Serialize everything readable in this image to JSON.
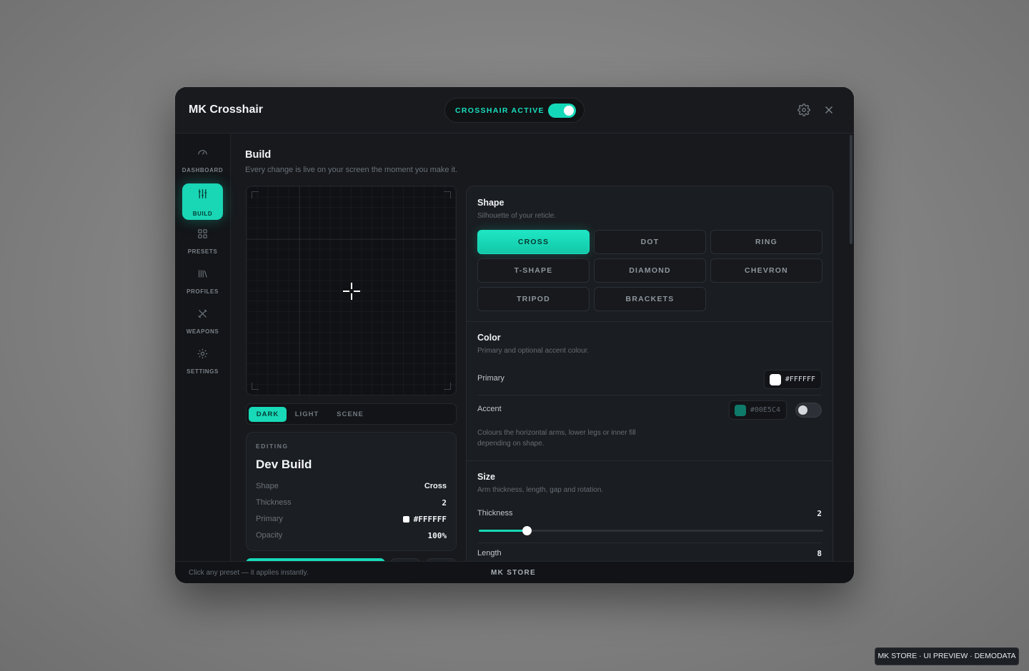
{
  "app": {
    "title": "MK Crosshair",
    "active_label": "CROSSHAIR ACTIVE",
    "active_on": true,
    "accent_color": "#18D9B8",
    "icons": {
      "settings": "gear-icon",
      "close": "close-icon"
    }
  },
  "sidebar": {
    "items": [
      {
        "label": "DASHBOARD",
        "icon": "gauge-icon",
        "active": false
      },
      {
        "label": "BUILD",
        "icon": "sliders-icon",
        "active": true
      },
      {
        "label": "PRESETS",
        "icon": "grid-icon",
        "active": false
      },
      {
        "label": "PROFILES",
        "icon": "library-icon",
        "active": false
      },
      {
        "label": "WEAPONS",
        "icon": "crossed-swords-icon",
        "active": false
      },
      {
        "label": "SETTINGS",
        "icon": "gear-icon",
        "active": false
      }
    ]
  },
  "page": {
    "title": "Build",
    "subtitle": "Every change is live on your screen the moment you make it."
  },
  "preview": {
    "background_tabs": [
      "DARK",
      "LIGHT",
      "SCENE"
    ],
    "active_background": "DARK"
  },
  "summary": {
    "kicker": "EDITING",
    "title": "Dev Build",
    "rows": [
      {
        "key": "Shape",
        "value": "Cross"
      },
      {
        "key": "Thickness",
        "value": "2"
      },
      {
        "key": "Primary",
        "value": "#FFFFFF"
      },
      {
        "key": "Opacity",
        "value": "100%"
      }
    ]
  },
  "shape": {
    "title": "Shape",
    "subtitle": "Silhouette of your reticle.",
    "options": [
      "CROSS",
      "DOT",
      "RING",
      "T-SHAPE",
      "DIAMOND",
      "CHEVRON",
      "TRIPOD",
      "BRACKETS"
    ],
    "selected": "CROSS"
  },
  "color": {
    "title": "Color",
    "subtitle": "Primary and optional accent colour.",
    "primary_label": "Primary",
    "primary_hex": "#FFFFFF",
    "accent_label": "Accent",
    "accent_hex": "#00E5C4",
    "accent_enabled": false,
    "note": "Colours the horizontal arms, lower legs or inner fill depending on shape."
  },
  "size": {
    "title": "Size",
    "subtitle": "Arm thickness, length, gap and rotation.",
    "thickness_label": "Thickness",
    "thickness_value": "2",
    "thickness_fraction": 0.14,
    "length_label": "Length",
    "length_value": "8"
  },
  "footer": {
    "hint": "Click any preset — it applies instantly.",
    "brand": "MK STORE"
  },
  "watermark": "MK STORE · UI PREVIEW · DEMODATA"
}
